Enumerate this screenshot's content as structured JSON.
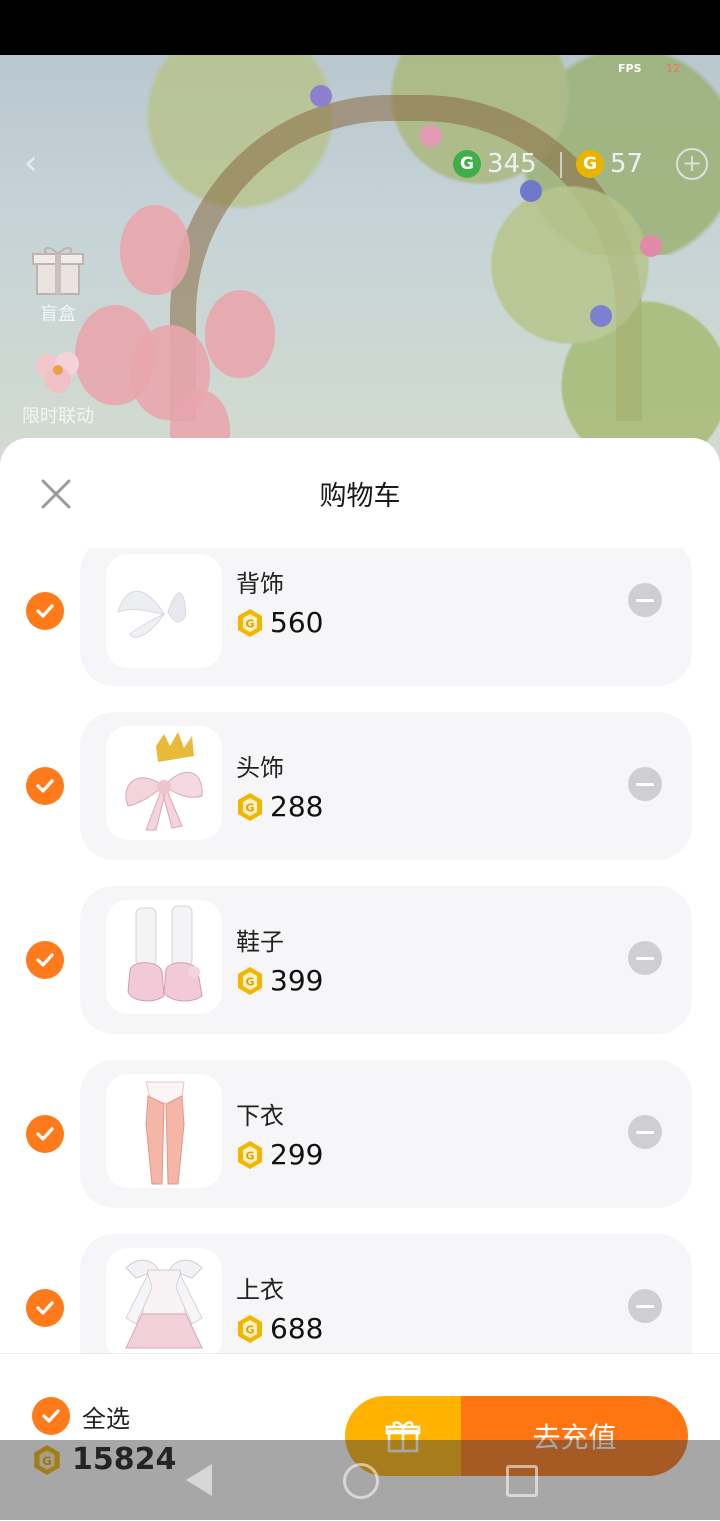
{
  "hud": {
    "fps_label": "FPS",
    "fps_value": "12"
  },
  "currencies": [
    {
      "icon": "green-g-coin-icon",
      "value": "345",
      "color": "#3fae4a"
    },
    {
      "icon": "gold-g-coin-icon",
      "value": "57",
      "color": "#e7b400"
    }
  ],
  "side_menu": [
    {
      "icon": "gift-box-icon",
      "label": "盲盒"
    },
    {
      "icon": "flower-icon",
      "label": "限时联动"
    }
  ],
  "cart": {
    "title": "购物车",
    "items": [
      {
        "name": "背饰",
        "price": "560",
        "image": "fairy-wings"
      },
      {
        "name": "头饰",
        "price": "288",
        "image": "bow-crown"
      },
      {
        "name": "鞋子",
        "price": "399",
        "image": "pink-shoes"
      },
      {
        "name": "下衣",
        "price": "299",
        "image": "pink-leggings"
      },
      {
        "name": "上衣",
        "price": "688",
        "image": "angel-dress"
      }
    ]
  },
  "footer": {
    "select_all_label": "全选",
    "total": "15824",
    "recharge_label": "去充值"
  },
  "colors": {
    "accent": "#ff7512",
    "gift_button": "#ffb300",
    "coin": "#f2b600"
  }
}
